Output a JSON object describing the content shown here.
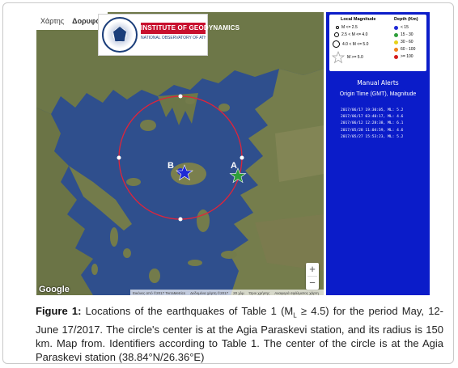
{
  "map": {
    "tabs": [
      "Χάρτης",
      "Δορυφόρος"
    ],
    "logo": {
      "banner": "INSTITUTE OF GEODYNAMICS",
      "subtitle": "NATIONAL OBSERVATORY OF ATHENS"
    },
    "labels": {
      "station_b": "B",
      "station_a": "A"
    },
    "zoom": {
      "in": "+",
      "out": "−"
    },
    "google": "Google",
    "attribution": [
      "Εικόνες από ©2017 TerraMetrics",
      "Δεδομένα χάρτη ©2017",
      "20 χλμ",
      "Όροι χρήσης",
      "Αναφορά σφάλματος χάρτη"
    ]
  },
  "legend": {
    "magnitude_header": "Local Magnitude",
    "depth_header": "Depth (Km)",
    "magnitude_rows": [
      "M <= 2.5",
      "2.5 < M <= 4.0",
      "4.0 < M <= 5.0",
      "M >= 5.0"
    ],
    "depth_rows": [
      {
        "label": "< 15",
        "color": "#1f2ad6"
      },
      {
        "label": "15 - 30",
        "color": "#2e9e3a"
      },
      {
        "label": "30 - 60",
        "color": "#e6d21a"
      },
      {
        "label": "60 - 100",
        "color": "#f0821e"
      },
      {
        "label": ">= 100",
        "color": "#d41c1c"
      }
    ]
  },
  "alerts": {
    "title": "Manual Alerts",
    "header": "Origin Time (GMT),  Magnitude",
    "items": [
      "2017/06/17 19:30:05, ML: 5.2",
      "2017/06/17 03:40:17, ML: 4.6",
      "2017/06/12 12:28:38, ML: 6.1",
      "2017/05/28 11:04:59, ML: 4.6",
      "2017/05/27 15:53:23, ML: 5.2"
    ]
  },
  "caption": {
    "label": "Figure 1:",
    "text_pre": " Locations of the earthquakes of Table 1 (M",
    "text_sub": "L",
    "text_post": " ≥ 4.5) for the period May, 12-June 17/2017. The circle's center is at the Agia Paraskevi station, and its radius is 150 km. Map from. Identifiers according to Table 1. The center of the circle is at the Agia Paraskevi station (38.84°N/26.36°E)"
  },
  "colors": {
    "sea": "#2e4f8e",
    "land": "#6f7a4a",
    "circle": "#e0243a",
    "legend_bg": "#0b1cc9",
    "star_a": "#2e9e3a",
    "star_b": "#1f2ad6",
    "banner": "#c8102e"
  }
}
